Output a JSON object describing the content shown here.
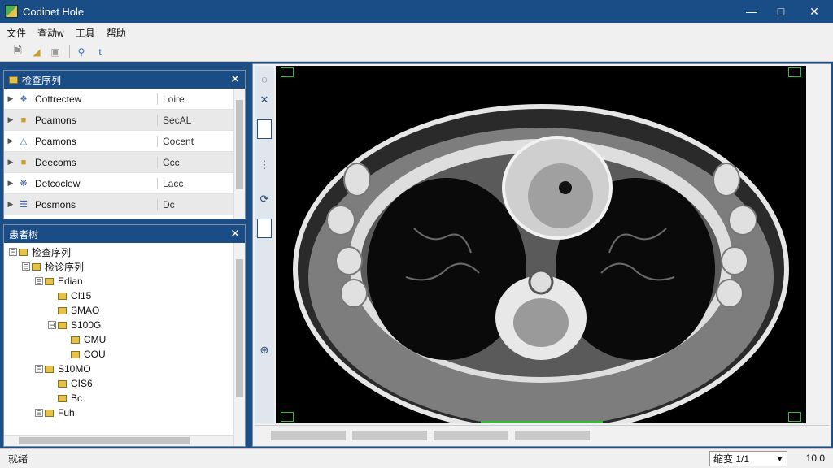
{
  "window": {
    "title": "Codinet Hole"
  },
  "menu": [
    "文件",
    "查动w",
    "工具",
    "帮助"
  ],
  "series_panel": {
    "title": "检查序列",
    "rows": [
      {
        "name": "Cottrectew",
        "value": "Loire"
      },
      {
        "name": "Poamons",
        "value": "SecAL"
      },
      {
        "name": "Poamons",
        "value": "Cocent"
      },
      {
        "name": "Deecoms",
        "value": "Ccc"
      },
      {
        "name": "Detcoclew",
        "value": "Lacc"
      },
      {
        "name": "Posmons",
        "value": "Dc"
      }
    ]
  },
  "tree_panel": {
    "title": "患者树",
    "items": [
      {
        "label": "检查序列",
        "level": 0,
        "toggle": "⊟"
      },
      {
        "label": "检诊序列",
        "level": 1,
        "toggle": "⊟"
      },
      {
        "label": "Edian",
        "level": 2,
        "toggle": "⊟"
      },
      {
        "label": "CI15",
        "level": 3,
        "toggle": ""
      },
      {
        "label": "SMAO",
        "level": 3,
        "toggle": ""
      },
      {
        "label": "S100G",
        "level": 3,
        "toggle": "⊟"
      },
      {
        "label": "CMU",
        "level": 4,
        "toggle": ""
      },
      {
        "label": "COU",
        "level": 4,
        "toggle": ""
      },
      {
        "label": "S10MO",
        "level": 2,
        "toggle": "⊟"
      },
      {
        "label": "CIS6",
        "level": 3,
        "toggle": ""
      },
      {
        "label": "Bc",
        "level": 3,
        "toggle": ""
      },
      {
        "label": "Fuh",
        "level": 2,
        "toggle": "⊟"
      }
    ]
  },
  "status": {
    "text": "就绪",
    "zoom_label": "缩变 1/1",
    "value": "10.0"
  }
}
